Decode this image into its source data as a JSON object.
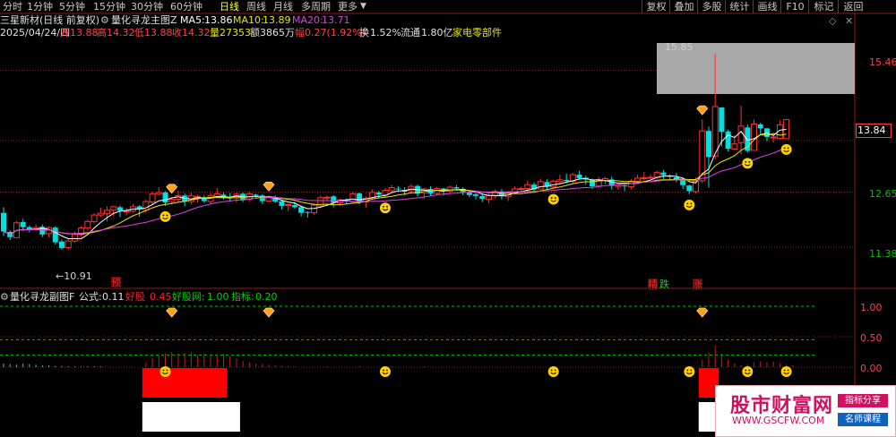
{
  "toolbar": {
    "periods": [
      {
        "label": "分时",
        "active": false
      },
      {
        "label": "1分钟",
        "active": false
      },
      {
        "label": "5分钟",
        "active": false
      },
      {
        "label": "15分钟",
        "active": false
      },
      {
        "label": "30分钟",
        "active": false
      },
      {
        "label": "60分钟",
        "active": false
      },
      {
        "label": "日线",
        "active": true
      },
      {
        "label": "周线",
        "active": false
      },
      {
        "label": "月线",
        "active": false
      },
      {
        "label": "多周期",
        "active": false
      },
      {
        "label": "更多",
        "active": false
      }
    ],
    "right_buttons": [
      "复权",
      "叠加",
      "多股",
      "统计",
      "画线",
      "F10",
      "标记",
      "返回"
    ]
  },
  "header": {
    "stock_name": "三星新材(日线 前复权)",
    "indicator_name": "量化寻龙主图Z",
    "ma5_label": "MA5:",
    "ma5_value": "13.86",
    "ma10_label": "MA10:",
    "ma10_value": "13.89",
    "ma20_label": "MA20:",
    "ma20_value": "13.71",
    "date": "2025/04/24/四",
    "open_label": "开",
    "open": "13.88",
    "high_label": "高",
    "high": "14.32",
    "low_label": "低",
    "low": "13.88",
    "close_label": "收",
    "close": "14.32",
    "volume_label": "量",
    "volume": "27353",
    "amount_label": "额",
    "amount": "3865万",
    "amplitude_label": "幅",
    "amplitude": "0.27(1.92%)",
    "turnover_label": "换",
    "turnover": "1.52%",
    "float_label": "流通",
    "float_cap": "1.80亿",
    "sector": "家电零部件"
  },
  "price_axis": {
    "ticks": [
      "15.46",
      "13.84",
      "12.65",
      "11.38"
    ],
    "current_price": "13.84"
  },
  "annotations": {
    "high_label": "15.85",
    "low_label": "←10.91",
    "tag_yu": "预",
    "tag_jing": "精",
    "tag_die": "跌",
    "tag_zhang": "涨"
  },
  "sub_header": {
    "name": "量化寻龙副图F",
    "formula_label": "公式:",
    "formula_value": "0.11",
    "good_stock_label": "好股",
    "good_stock_value": "0.45",
    "net_label": "好股网:",
    "net_value": "1.00",
    "index_label": "指标:",
    "index_value": "0.20"
  },
  "sub_axis": {
    "ticks": [
      "1.00",
      "0.50",
      "0.00"
    ]
  },
  "watermark": {
    "title": "股市财富网",
    "url": "WWW.GSCFW.COM",
    "badge1": "指标分享",
    "badge2": "名师课程"
  },
  "colors": {
    "up": "#ff3232",
    "down": "#00e0e0",
    "ma5": "#ffffff",
    "ma10": "#e6e600",
    "ma20": "#e040e0",
    "grid": "#8b1a1a",
    "sub_red": "#ff0000",
    "sub_white": "#ffffff",
    "green_dash": "#00c000"
  },
  "candles": [
    [
      12.17,
      11.74,
      12.3,
      11.64
    ],
    [
      11.73,
      11.61,
      11.77,
      11.54
    ],
    [
      11.6,
      11.94,
      11.98,
      11.59
    ],
    [
      11.96,
      11.84,
      12.03,
      11.75
    ],
    [
      11.84,
      11.78,
      11.88,
      11.72
    ],
    [
      11.8,
      11.83,
      11.9,
      11.77
    ],
    [
      11.85,
      11.67,
      11.9,
      11.61
    ],
    [
      11.69,
      11.83,
      11.86,
      11.61
    ],
    [
      11.83,
      11.49,
      11.86,
      11.44
    ],
    [
      11.51,
      11.36,
      11.55,
      11.33
    ],
    [
      11.37,
      11.52,
      11.57,
      11.32
    ],
    [
      11.52,
      11.67,
      11.74,
      11.48
    ],
    [
      11.67,
      11.82,
      11.86,
      11.61
    ],
    [
      11.82,
      11.97,
      12.01,
      11.76
    ],
    [
      11.97,
      12.12,
      12.16,
      11.93
    ],
    [
      12.12,
      12.16,
      12.29,
      12.07
    ],
    [
      12.15,
      12.23,
      12.32,
      11.97
    ],
    [
      12.23,
      12.31,
      12.34,
      12.1
    ],
    [
      12.3,
      12.22,
      12.34,
      12.07
    ],
    [
      12.21,
      12.21,
      12.28,
      12.11
    ],
    [
      12.21,
      12.31,
      12.37,
      12.18
    ],
    [
      12.32,
      12.25,
      12.35,
      12.08
    ],
    [
      12.24,
      12.43,
      12.47,
      12.18
    ],
    [
      12.42,
      12.61,
      12.66,
      12.37
    ],
    [
      12.6,
      12.64,
      12.76,
      12.57
    ],
    [
      12.64,
      12.41,
      12.67,
      12.33
    ],
    [
      12.43,
      12.48,
      12.52,
      12.36
    ],
    [
      12.48,
      12.57,
      12.68,
      12.42
    ],
    [
      12.57,
      12.43,
      12.61,
      12.32
    ],
    [
      12.43,
      12.56,
      12.64,
      12.36
    ],
    [
      12.55,
      12.55,
      12.59,
      12.41
    ],
    [
      12.53,
      12.44,
      12.57,
      12.4
    ],
    [
      12.43,
      12.57,
      12.63,
      12.37
    ],
    [
      12.55,
      12.61,
      12.74,
      12.52
    ],
    [
      12.59,
      12.53,
      12.64,
      12.48
    ],
    [
      12.52,
      12.51,
      12.63,
      12.43
    ],
    [
      12.51,
      12.6,
      12.64,
      12.41
    ],
    [
      12.61,
      12.46,
      12.64,
      12.42
    ],
    [
      12.48,
      12.61,
      12.65,
      12.43
    ],
    [
      12.59,
      12.56,
      12.61,
      12.51
    ],
    [
      12.57,
      12.44,
      12.6,
      12.38
    ],
    [
      12.44,
      12.54,
      12.57,
      12.42
    ],
    [
      12.52,
      12.43,
      12.57,
      12.4
    ],
    [
      12.44,
      12.33,
      12.45,
      12.25
    ],
    [
      12.34,
      12.36,
      12.39,
      12.21
    ],
    [
      12.35,
      12.3,
      12.43,
      12.27
    ],
    [
      12.3,
      12.17,
      12.34,
      12.09
    ],
    [
      12.19,
      12.17,
      12.21,
      12.06
    ],
    [
      12.17,
      12.35,
      12.39,
      12.13
    ],
    [
      12.33,
      12.52,
      12.57,
      12.28
    ],
    [
      12.52,
      12.53,
      12.57,
      12.44
    ],
    [
      12.55,
      12.4,
      12.58,
      12.3
    ],
    [
      12.4,
      12.47,
      12.49,
      12.33
    ],
    [
      12.47,
      12.44,
      12.5,
      12.37
    ],
    [
      12.43,
      12.61,
      12.66,
      12.38
    ],
    [
      12.62,
      12.41,
      12.64,
      12.37
    ],
    [
      12.42,
      12.51,
      12.55,
      12.29
    ],
    [
      12.5,
      12.64,
      12.71,
      12.47
    ],
    [
      12.64,
      12.59,
      12.68,
      12.52
    ],
    [
      12.58,
      12.69,
      12.74,
      12.53
    ],
    [
      12.68,
      12.75,
      12.81,
      12.65
    ],
    [
      12.73,
      12.71,
      12.79,
      12.66
    ],
    [
      12.7,
      12.66,
      12.76,
      12.57
    ],
    [
      12.68,
      12.78,
      12.83,
      12.61
    ],
    [
      12.79,
      12.61,
      12.82,
      12.55
    ],
    [
      12.63,
      12.72,
      12.74,
      12.49
    ],
    [
      12.72,
      12.61,
      12.78,
      12.56
    ],
    [
      12.62,
      12.73,
      12.77,
      12.57
    ],
    [
      12.73,
      12.68,
      12.75,
      12.57
    ],
    [
      12.67,
      12.76,
      12.8,
      12.62
    ],
    [
      12.76,
      12.73,
      12.81,
      12.68
    ],
    [
      12.72,
      12.65,
      12.76,
      12.58
    ],
    [
      12.65,
      12.58,
      12.7,
      12.53
    ],
    [
      12.6,
      12.56,
      12.66,
      12.48
    ],
    [
      12.56,
      12.49,
      12.62,
      12.42
    ],
    [
      12.48,
      12.57,
      12.6,
      12.39
    ],
    [
      12.56,
      12.66,
      12.71,
      12.5
    ],
    [
      12.66,
      12.55,
      12.72,
      12.48
    ],
    [
      12.54,
      12.64,
      12.67,
      12.44
    ],
    [
      12.64,
      12.72,
      12.78,
      12.59
    ],
    [
      12.71,
      12.73,
      12.77,
      12.63
    ],
    [
      12.73,
      12.82,
      12.91,
      12.67
    ],
    [
      12.82,
      12.71,
      12.87,
      12.66
    ],
    [
      12.72,
      12.89,
      12.95,
      12.71
    ],
    [
      12.88,
      12.77,
      12.94,
      12.71
    ],
    [
      12.77,
      12.9,
      12.93,
      12.73
    ],
    [
      12.89,
      12.93,
      13.05,
      12.85
    ],
    [
      12.93,
      12.9,
      13.07,
      12.85
    ],
    [
      12.9,
      13.05,
      13.09,
      12.86
    ],
    [
      13.05,
      12.97,
      13.14,
      12.93
    ],
    [
      12.98,
      12.94,
      13.03,
      12.82
    ],
    [
      12.93,
      12.78,
      12.96,
      12.72
    ],
    [
      12.79,
      12.93,
      13.0,
      12.77
    ],
    [
      12.92,
      12.96,
      13.0,
      12.83
    ],
    [
      12.94,
      12.79,
      13.0,
      12.71
    ],
    [
      12.78,
      12.81,
      12.82,
      12.7
    ],
    [
      12.8,
      12.78,
      12.83,
      12.67
    ],
    [
      12.77,
      12.9,
      12.95,
      12.71
    ],
    [
      12.9,
      12.97,
      13.05,
      12.86
    ],
    [
      12.98,
      12.98,
      13.11,
      12.93
    ],
    [
      12.98,
      12.99,
      13.06,
      12.93
    ],
    [
      12.99,
      13.1,
      13.14,
      12.96
    ],
    [
      13.1,
      13.04,
      13.16,
      12.95
    ],
    [
      13.03,
      13.0,
      13.06,
      12.92
    ],
    [
      12.99,
      12.92,
      13.09,
      12.88
    ],
    [
      12.92,
      12.81,
      12.98,
      12.72
    ],
    [
      12.8,
      12.67,
      12.82,
      12.6
    ],
    [
      12.66,
      12.9,
      12.98,
      12.62
    ],
    [
      12.91,
      14.06,
      14.33,
      12.86
    ],
    [
      14.06,
      13.46,
      14.16,
      12.75
    ],
    [
      13.48,
      14.62,
      15.85,
      13.4
    ],
    [
      14.6,
      14.04,
      14.18,
      13.7
    ],
    [
      14.05,
      13.65,
      14.09,
      13.59
    ],
    [
      13.64,
      13.76,
      13.96,
      13.62
    ],
    [
      13.79,
      14.17,
      14.64,
      13.52
    ],
    [
      14.14,
      13.6,
      14.21,
      13.56
    ],
    [
      13.61,
      14.22,
      14.33,
      13.64
    ],
    [
      14.21,
      14.12,
      14.25,
      13.97
    ],
    [
      14.12,
      13.92,
      14.12,
      13.82
    ],
    [
      13.92,
      13.92,
      13.98,
      13.79
    ],
    [
      13.89,
      14.2,
      14.3,
      13.86
    ],
    [
      13.88,
      14.32,
      14.32,
      13.88
    ]
  ],
  "sub_bars": [
    {
      "i": 0,
      "up": 0.06,
      "dn": 0.0
    },
    {
      "i": 1,
      "up": 0.05,
      "dn": 0.0
    },
    {
      "i": 2,
      "up": 0.04,
      "dn": 0.0
    },
    {
      "i": 3,
      "up": 0.06,
      "dn": 0.0
    },
    {
      "i": 4,
      "up": 0.05,
      "dn": 0.0
    },
    {
      "i": 5,
      "up": 0.04,
      "dn": 0.0
    },
    {
      "i": 6,
      "up": 0.03,
      "dn": 0.0
    },
    {
      "i": 7,
      "up": 0.03,
      "dn": 0.0
    },
    {
      "i": 8,
      "up": 0.02,
      "dn": 0.0
    },
    {
      "i": 9,
      "up": 0.02,
      "dn": 0.0
    },
    {
      "i": 10,
      "up": 0.01,
      "dn": 0.0
    },
    {
      "i": 11,
      "up": 0.01,
      "dn": 0.0
    },
    {
      "i": 12,
      "up": 0.01,
      "dn": 0.0
    },
    {
      "i": 13,
      "up": 0.0,
      "dn": 0.0
    },
    {
      "i": 14,
      "up": 0.0,
      "dn": 0.0
    },
    {
      "i": 15,
      "up": 0.0,
      "dn": 0.0
    },
    {
      "i": 22,
      "up": 0.08,
      "dn": 0.0
    },
    {
      "i": 23,
      "up": 0.15,
      "dn": 0.0
    },
    {
      "i": 24,
      "up": 0.2,
      "dn": 0.0
    },
    {
      "i": 25,
      "up": 0.22,
      "dn": 0.0
    },
    {
      "i": 26,
      "up": 0.25,
      "dn": 0.0
    },
    {
      "i": 27,
      "up": 0.22,
      "dn": 0.0
    },
    {
      "i": 28,
      "up": 0.23,
      "dn": 0.0
    },
    {
      "i": 29,
      "up": 0.24,
      "dn": 0.0
    },
    {
      "i": 30,
      "up": 0.2,
      "dn": 0.0
    },
    {
      "i": 31,
      "up": 0.22,
      "dn": 0.0
    },
    {
      "i": 32,
      "up": 0.2,
      "dn": 0.0
    },
    {
      "i": 33,
      "up": 0.21,
      "dn": 0.0
    },
    {
      "i": 34,
      "up": 0.22,
      "dn": 0.0
    },
    {
      "i": 35,
      "up": 0.18,
      "dn": 0.0
    },
    {
      "i": 36,
      "up": 0.14,
      "dn": 0.0
    },
    {
      "i": 37,
      "up": 0.1,
      "dn": 0.0
    },
    {
      "i": 38,
      "up": 0.08,
      "dn": 0.0
    },
    {
      "i": 39,
      "up": 0.06,
      "dn": 0.0
    },
    {
      "i": 40,
      "up": 0.05,
      "dn": 0.0
    },
    {
      "i": 41,
      "up": 0.04,
      "dn": 0.0
    },
    {
      "i": 42,
      "up": 0.03,
      "dn": 0.0
    },
    {
      "i": 43,
      "up": 0.02,
      "dn": 0.0
    },
    {
      "i": 44,
      "up": 0.02,
      "dn": 0.0
    },
    {
      "i": 45,
      "up": 0.01,
      "dn": 0.0
    },
    {
      "i": 50,
      "up": 0.01,
      "dn": 0.0
    },
    {
      "i": 55,
      "up": 0.01,
      "dn": 0.0
    },
    {
      "i": 60,
      "up": 0.01,
      "dn": 0.0
    },
    {
      "i": 65,
      "up": 0.01,
      "dn": 0.0
    },
    {
      "i": 108,
      "up": 0.12,
      "dn": 0.0
    },
    {
      "i": 109,
      "up": 0.24,
      "dn": 0.0
    },
    {
      "i": 110,
      "up": 0.36,
      "dn": 0.0
    },
    {
      "i": 111,
      "up": 0.22,
      "dn": 0.0
    },
    {
      "i": 112,
      "up": 0.12,
      "dn": 0.0
    },
    {
      "i": 113,
      "up": 0.06,
      "dn": 0.0
    },
    {
      "i": 114,
      "up": 0.03,
      "dn": 0.0
    },
    {
      "i": 115,
      "up": 0.04,
      "dn": 0.0
    },
    {
      "i": 116,
      "up": 0.08,
      "dn": 0.0
    },
    {
      "i": 117,
      "up": 0.1,
      "dn": 0.0
    },
    {
      "i": 118,
      "up": 0.08,
      "dn": 0.0
    },
    {
      "i": 119,
      "up": 0.09,
      "dn": 0.0
    },
    {
      "i": 120,
      "up": 0.06,
      "dn": 0.0
    },
    {
      "i": 121,
      "up": 0.04,
      "dn": 0.0
    },
    {
      "i": 122,
      "up": 0.03,
      "dn": 0.0
    }
  ],
  "red_white_blocks": [
    22,
    23,
    24,
    25,
    26,
    27,
    28,
    29,
    30,
    31,
    32,
    33,
    34,
    108,
    109,
    110
  ],
  "white_only_blocks": [
    35,
    36
  ],
  "diamond_main": [
    26,
    41,
    108
  ],
  "smiley_main": [
    25,
    59,
    85,
    106,
    115,
    129
  ],
  "smiley_sub": [
    25,
    59,
    85,
    106,
    115,
    129
  ],
  "diamond_sub": [
    26,
    41,
    108
  ]
}
